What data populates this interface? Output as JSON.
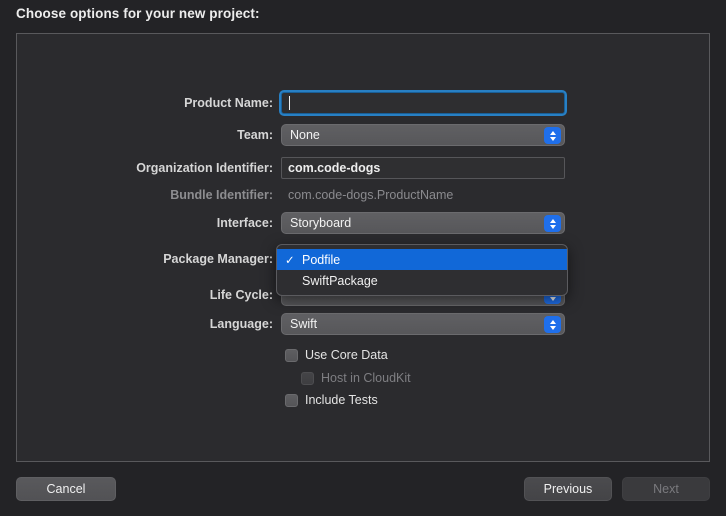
{
  "dialog": {
    "title": "Choose options for your new project:"
  },
  "form": {
    "rows": [
      {
        "label": "Product Name:",
        "value": "",
        "placeholder": "",
        "type": "textfield-focused"
      },
      {
        "label": "Team:",
        "value": "None",
        "type": "popup"
      },
      {
        "label": "Organization Identifier:",
        "value": "com.code-dogs",
        "type": "textfield"
      },
      {
        "label": "Bundle Identifier:",
        "value": "com.code-dogs.ProductName",
        "type": "readonly"
      },
      {
        "label": "Interface:",
        "value": "Storyboard",
        "type": "popup"
      },
      {
        "label": "Package Manager:",
        "value": "Podfile",
        "type": "popup-open"
      },
      {
        "label": "Life Cycle:",
        "value": "",
        "type": "popup"
      },
      {
        "label": "Language:",
        "value": "Swift",
        "type": "popup"
      }
    ],
    "checkboxes": [
      {
        "label": "Use Core Data",
        "checked": false,
        "disabled": false
      },
      {
        "label": "Host in CloudKit",
        "checked": false,
        "disabled": true
      },
      {
        "label": "Include Tests",
        "checked": false,
        "disabled": false
      }
    ]
  },
  "package_manager_menu": {
    "items": [
      {
        "label": "Podfile",
        "selected": true,
        "check": "✓"
      },
      {
        "label": "SwiftPackage",
        "selected": false,
        "check": "✓"
      }
    ]
  },
  "footer": {
    "cancel_label": "Cancel",
    "previous_label": "Previous",
    "next_label": "Next"
  },
  "colors": {
    "accent_blue": "#1168d8",
    "focus_ring": "#2880c4",
    "window_bg": "#232326",
    "panel_bg": "#2b2b2e"
  }
}
